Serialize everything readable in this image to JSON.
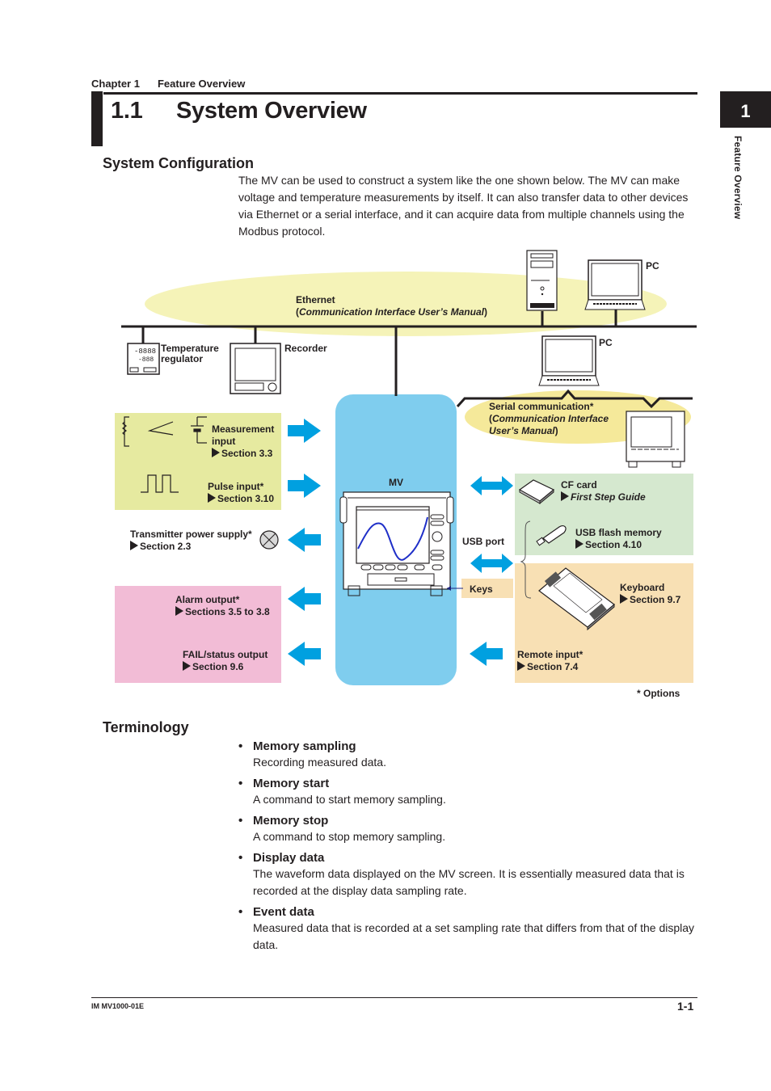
{
  "header": {
    "chapter": "Chapter 1",
    "chapter_title": "Feature Overview",
    "section_number": "1.1",
    "section_title": "System Overview",
    "tab_number": "1",
    "tab_label": "Feature Overview"
  },
  "system_configuration": {
    "heading": "System Configuration",
    "intro": "The MV can be used to construct a system like the one shown below. The MV can make voltage and temperature measurements by itself. It can also transfer data to other devices via Ethernet or a serial interface, and it can acquire data from multiple channels using the Modbus protocol."
  },
  "diagram": {
    "ethernet": {
      "title": "Ethernet",
      "ref_open": "(",
      "ref": "Communication Interface User’s Manual",
      "ref_close": ")"
    },
    "pc_top": "PC",
    "pc_mid": "PC",
    "temp_regulator": [
      "Temperature",
      "regulator"
    ],
    "recorder": "Recorder",
    "serial": {
      "title": "Serial communication*",
      "ref_line1": "Communication Interface",
      "ref_line2": "User’s Manual"
    },
    "mv_label": "MV",
    "usb_port": "USB port",
    "keys": "Keys",
    "measurement_input": {
      "title": [
        "Measurement",
        "input"
      ],
      "ref": "Section 3.3"
    },
    "pulse_input": {
      "title": "Pulse input*",
      "ref": "Section 3.10"
    },
    "transmitter_power": {
      "title": "Transmitter power supply*",
      "ref": "Section 2.3"
    },
    "alarm_output": {
      "title": "Alarm output*",
      "ref": "Sections 3.5 to 3.8"
    },
    "fail_output": {
      "title": "FAIL/status output",
      "ref": "Section 9.6"
    },
    "cf_card": {
      "title": "CF card",
      "ref": "First Step Guide"
    },
    "usb_flash": {
      "title": "USB flash memory",
      "ref": "Section 4.10"
    },
    "keyboard": {
      "title": "Keyboard",
      "ref": "Section 9.7"
    },
    "remote_input": {
      "title": "Remote input*",
      "ref": "Section 7.4"
    },
    "options_note": "* Options",
    "colors": {
      "ethernet_ellipse": "#f5f3b8",
      "mv_panel": "#7fcdee",
      "arrow": "#00a0e0",
      "input_box": "#e6eaa0",
      "output_box": "#f2bcd6",
      "storage_box": "#d5e8cf",
      "keys_box": "#f8e0b4",
      "waveform": "#1f2fc8"
    }
  },
  "terminology": {
    "heading": "Terminology",
    "bullet": "•",
    "items": [
      {
        "term": "Memory sampling",
        "desc": "Recording measured data."
      },
      {
        "term": "Memory start",
        "desc": "A command to start memory sampling."
      },
      {
        "term": "Memory stop",
        "desc": "A command to stop memory sampling."
      },
      {
        "term": "Display data",
        "desc": "The waveform data displayed on the MV screen. It is essentially measured data that is recorded at the display data sampling rate."
      },
      {
        "term": "Event data",
        "desc": "Measured data that is recorded at a set sampling rate that differs from that of the display data."
      }
    ]
  },
  "footer": {
    "doc_id": "IM MV1000-01E",
    "page": "1-1"
  }
}
